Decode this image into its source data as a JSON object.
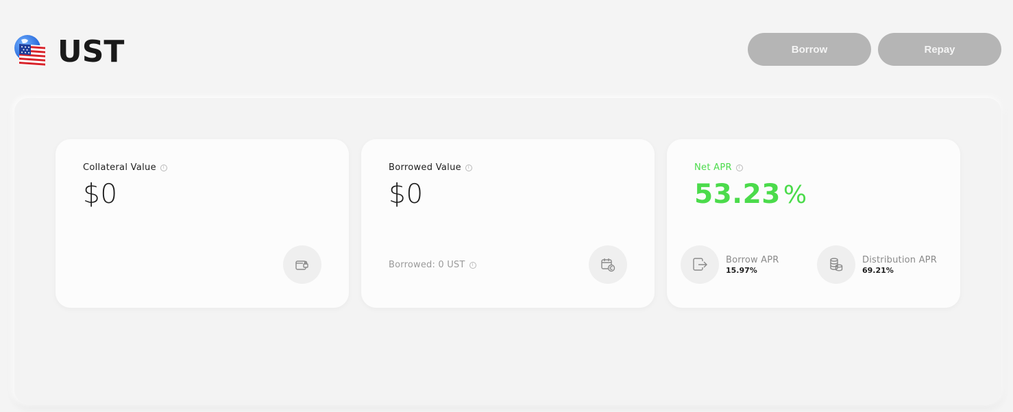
{
  "header": {
    "title": "UST",
    "logo_icon": "ust-flag-logo-icon",
    "borrow_label": "Borrow",
    "repay_label": "Repay"
  },
  "cards": {
    "collateral": {
      "label": "Collateral Value",
      "value": "$0",
      "icon": "wallet-lock-icon"
    },
    "borrowed": {
      "label": "Borrowed Value",
      "value": "$0",
      "borrowed_text": "Borrowed: 0 UST",
      "icon": "calendar-coin-icon"
    },
    "net_apr": {
      "label": "Net APR",
      "value": "53.23",
      "unit": "%",
      "borrow_apr_label": "Borrow APR",
      "borrow_apr_value": "15.97%",
      "borrow_apr_icon": "wallet-out-icon",
      "distribution_apr_label": "Distribution APR",
      "distribution_apr_value": "69.21%",
      "distribution_apr_icon": "coin-stack-icon"
    }
  },
  "colors": {
    "accent_green": "#4bdb4b",
    "button_disabled": "#b5b5b5",
    "background": "#f4f4f4"
  }
}
